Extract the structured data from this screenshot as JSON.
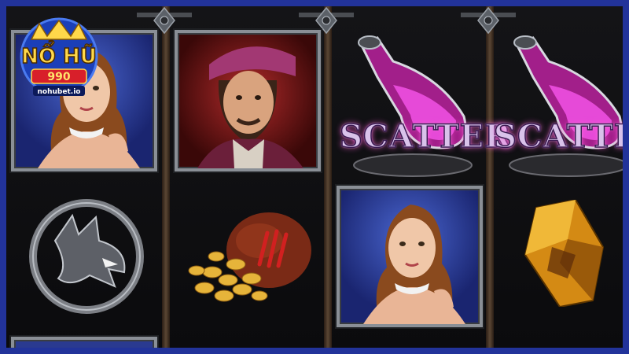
{
  "logo": {
    "title": "NỔ HŨ",
    "number": "990",
    "domain": "nohubet.io"
  },
  "reels": [
    {
      "id": 1,
      "symbols": [
        "woman-portrait",
        "wolf-medallion",
        "woman-portrait"
      ]
    },
    {
      "id": 2,
      "symbols": [
        "man-portrait",
        "coin-pouch"
      ]
    },
    {
      "id": 3,
      "symbols": [
        "scatter-potion",
        "woman-portrait"
      ]
    },
    {
      "id": 4,
      "symbols": [
        "scatter-potion",
        "amber-crystal"
      ]
    }
  ],
  "scatter_label": "SCATTER",
  "colors": {
    "background": "#22339a",
    "reel": "#0d0d0f",
    "frame_metal": "#8a8f96",
    "scatter_glow": "#ff5cd8",
    "gold": "#e6b43a"
  }
}
